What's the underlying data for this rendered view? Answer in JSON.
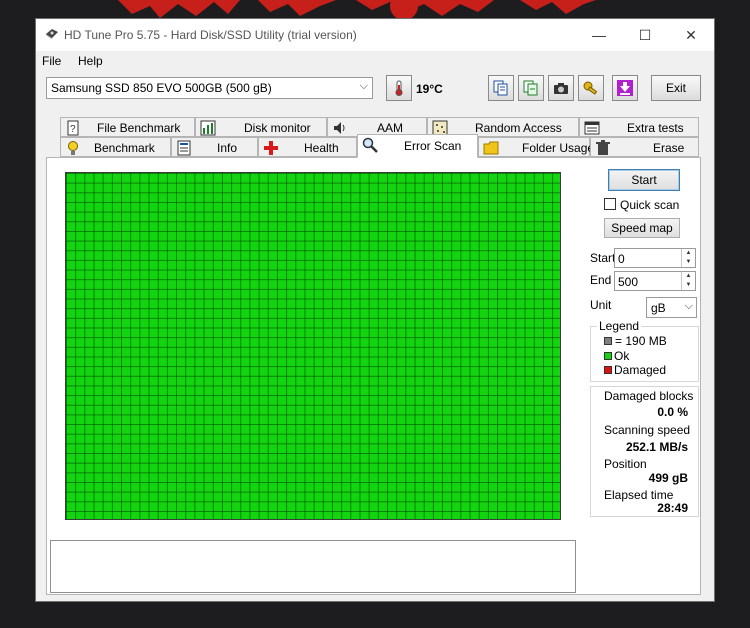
{
  "window": {
    "title": "HD Tune Pro 5.75 - Hard Disk/SSD Utility (trial version)",
    "minimize_glyph": "—",
    "maximize_glyph": "☐",
    "close_glyph": "✕"
  },
  "menu": {
    "items": [
      "File",
      "Help"
    ]
  },
  "toolbar": {
    "drive_selected": "Samsung SSD 850 EVO 500GB (500 gB)",
    "temperature": "19°C",
    "exit_label": "Exit",
    "icons": [
      "copy-info-icon",
      "copy-screen-icon",
      "camera-icon",
      "settings-key-icon",
      "save-down-icon"
    ]
  },
  "tabs": {
    "row1": [
      {
        "label": "File Benchmark",
        "icon": "file-benchmark-icon"
      },
      {
        "label": "Disk monitor",
        "icon": "disk-monitor-icon"
      },
      {
        "label": "AAM",
        "icon": "speaker-icon"
      },
      {
        "label": "Random Access",
        "icon": "random-access-icon"
      },
      {
        "label": "Extra tests",
        "icon": "extra-tests-icon"
      }
    ],
    "row2": [
      {
        "label": "Benchmark",
        "icon": "bulb-icon"
      },
      {
        "label": "Info",
        "icon": "info-icon"
      },
      {
        "label": "Health",
        "icon": "health-cross-icon"
      },
      {
        "label": "Error Scan",
        "icon": "magnifier-icon",
        "active": true
      },
      {
        "label": "Folder Usage",
        "icon": "folder-icon"
      },
      {
        "label": "Erase",
        "icon": "trash-icon"
      }
    ]
  },
  "scan": {
    "start_label": "Start",
    "quick_scan_label": "Quick scan",
    "quick_scan_checked": false,
    "speed_map_label": "Speed map",
    "start_field_label": "Start",
    "start_value": "0",
    "end_field_label": "End",
    "end_value": "500",
    "unit_label": "Unit",
    "unit_value": "gB",
    "block_status": "all ok"
  },
  "legend": {
    "title": "Legend",
    "items": [
      {
        "color": "#808080",
        "label": "= 190 MB"
      },
      {
        "color": "#13d50f",
        "label": "Ok"
      },
      {
        "color": "#e0120f",
        "label": "Damaged"
      }
    ]
  },
  "stats": {
    "damaged_blocks_label": "Damaged blocks",
    "damaged_blocks_value": "0.0 %",
    "scanning_speed_label": "Scanning speed",
    "scanning_speed_value": "252.1 MB/s",
    "position_label": "Position",
    "position_value": "499 gB",
    "elapsed_label": "Elapsed time",
    "elapsed_value": "28:49"
  },
  "colors": {
    "grid_ok": "#13d50f",
    "grid_lines": "#1c5a1b",
    "damaged": "#e0120f",
    "background_art": "#c7201b"
  }
}
